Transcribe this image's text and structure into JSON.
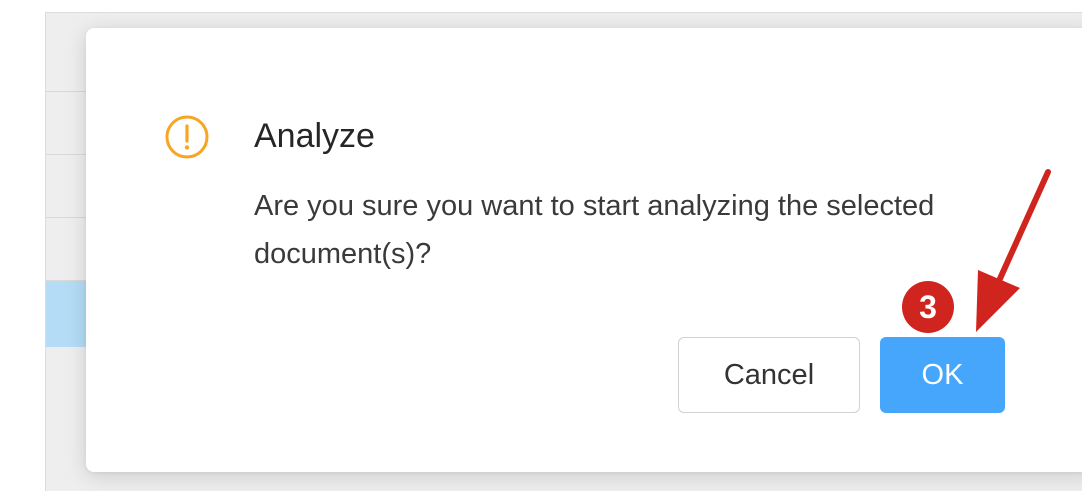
{
  "dialog": {
    "title": "Analyze",
    "message": "Are you sure you want to start analyzing the selected document(s)?",
    "icon": "exclamation-circle-icon",
    "cancel_label": "Cancel",
    "ok_label": "OK"
  },
  "annotation": {
    "step_number": "3",
    "arrow_icon": "red-arrow-icon",
    "color": "#d0251f"
  },
  "colors": {
    "warning": "#f6a623",
    "primary": "#45a6fb",
    "selected_row": "#b5dcf7"
  }
}
